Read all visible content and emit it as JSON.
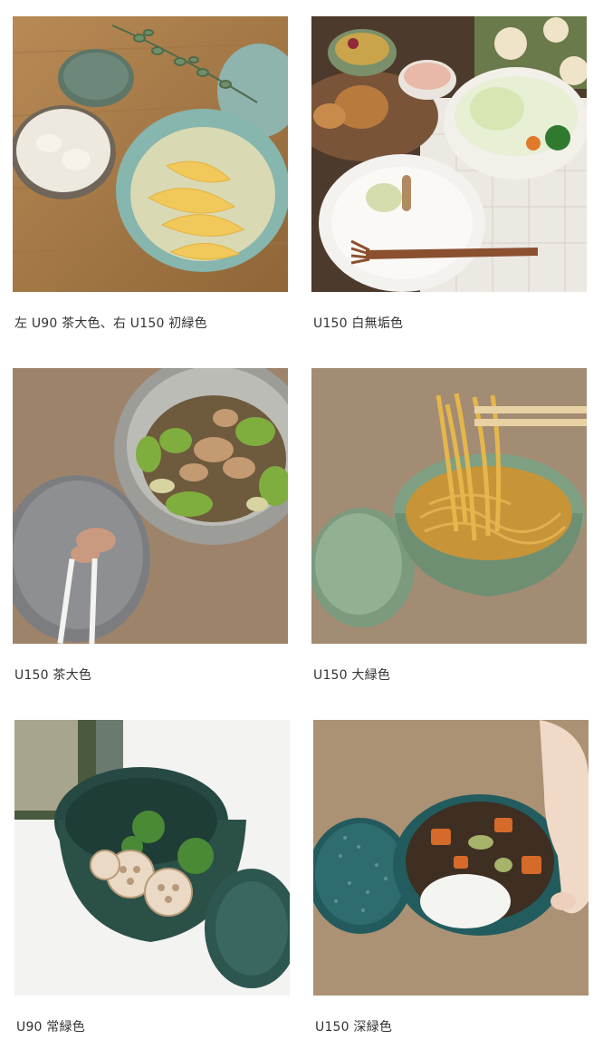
{
  "gallery": {
    "items": [
      {
        "caption": "左 U90 茶大色、右 U150 初緑色"
      },
      {
        "caption": "U150 白無垢色"
      },
      {
        "caption": "U150 茶大色"
      },
      {
        "caption": "U150 大緑色"
      },
      {
        "caption": "U90 常緑色"
      },
      {
        "caption": "U150 深緑色"
      }
    ]
  },
  "photos": {
    "0": {
      "label_lines": [
        "",
        "",
        "",
        "",
        "",
        "",
        ""
      ]
    }
  }
}
